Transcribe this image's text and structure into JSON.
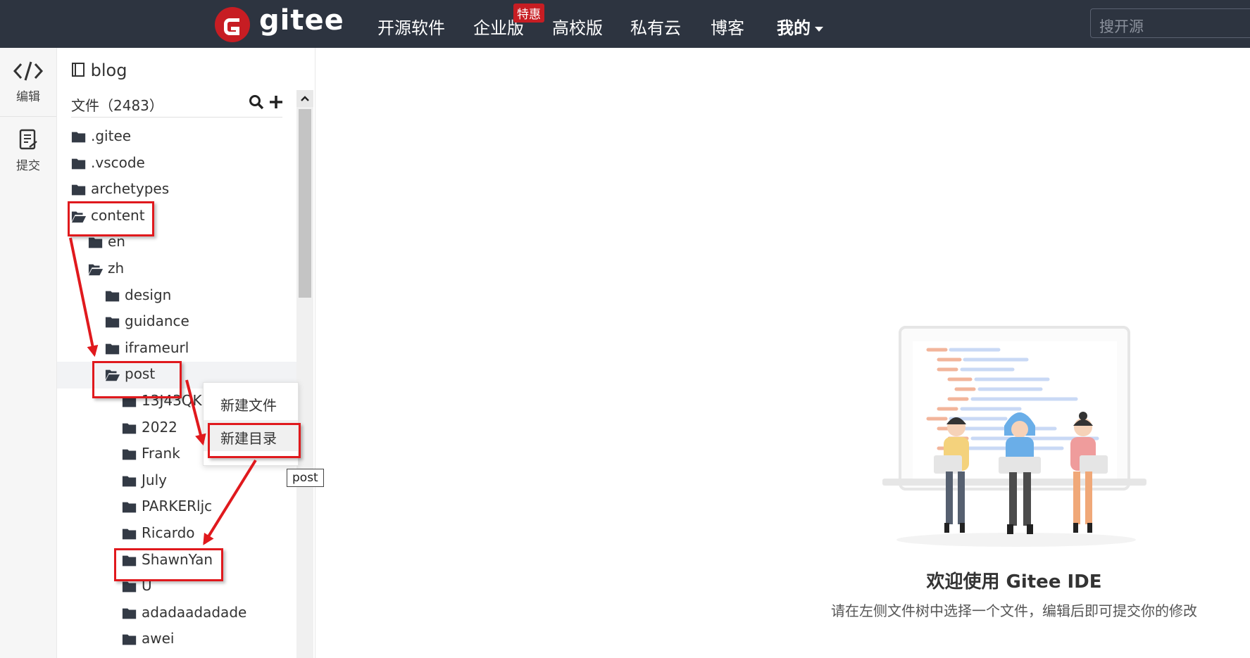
{
  "header": {
    "brand": "gitee",
    "nav": [
      {
        "label": "开源软件"
      },
      {
        "label": "企业版"
      },
      {
        "label": "高校版"
      },
      {
        "label": "私有云"
      },
      {
        "label": "博客"
      },
      {
        "label": "我的"
      }
    ],
    "promo_badge": "特惠",
    "search_placeholder": "搜开源"
  },
  "rail": {
    "edit_label": "编辑",
    "commit_label": "提交"
  },
  "tree": {
    "repo_name": "blog",
    "files_header": "文件（2483）",
    "items": [
      {
        "name": ".gitee",
        "depth": 0,
        "open": false
      },
      {
        "name": ".vscode",
        "depth": 0,
        "open": false
      },
      {
        "name": "archetypes",
        "depth": 0,
        "open": false
      },
      {
        "name": "content",
        "depth": 0,
        "open": true
      },
      {
        "name": "en",
        "depth": 1,
        "open": false
      },
      {
        "name": "zh",
        "depth": 1,
        "open": true
      },
      {
        "name": "design",
        "depth": 2,
        "open": false
      },
      {
        "name": "guidance",
        "depth": 2,
        "open": false
      },
      {
        "name": "iframeurl",
        "depth": 2,
        "open": false
      },
      {
        "name": "post",
        "depth": 2,
        "open": true
      },
      {
        "name": "13J43QK",
        "depth": 3,
        "open": false
      },
      {
        "name": "2022",
        "depth": 3,
        "open": false
      },
      {
        "name": "Frank",
        "depth": 3,
        "open": false
      },
      {
        "name": "July",
        "depth": 3,
        "open": false
      },
      {
        "name": "PARKERljc",
        "depth": 3,
        "open": false
      },
      {
        "name": "Ricardo",
        "depth": 3,
        "open": false
      },
      {
        "name": "ShawnYan",
        "depth": 3,
        "open": false
      },
      {
        "name": "U",
        "depth": 3,
        "open": false
      },
      {
        "name": "adadaadadade",
        "depth": 3,
        "open": false
      },
      {
        "name": "awei",
        "depth": 3,
        "open": false
      }
    ]
  },
  "context_menu": {
    "new_file": "新建文件",
    "new_folder": "新建目录"
  },
  "tooltip": "post",
  "welcome": {
    "title": "欢迎使用 Gitee IDE",
    "subtitle": "请在左侧文件树中选择一个文件，编辑后即可提交你的修改"
  },
  "colors": {
    "topbar": "#2d3440",
    "brand_red": "#c71d23",
    "annotation_red": "#e0191d"
  }
}
